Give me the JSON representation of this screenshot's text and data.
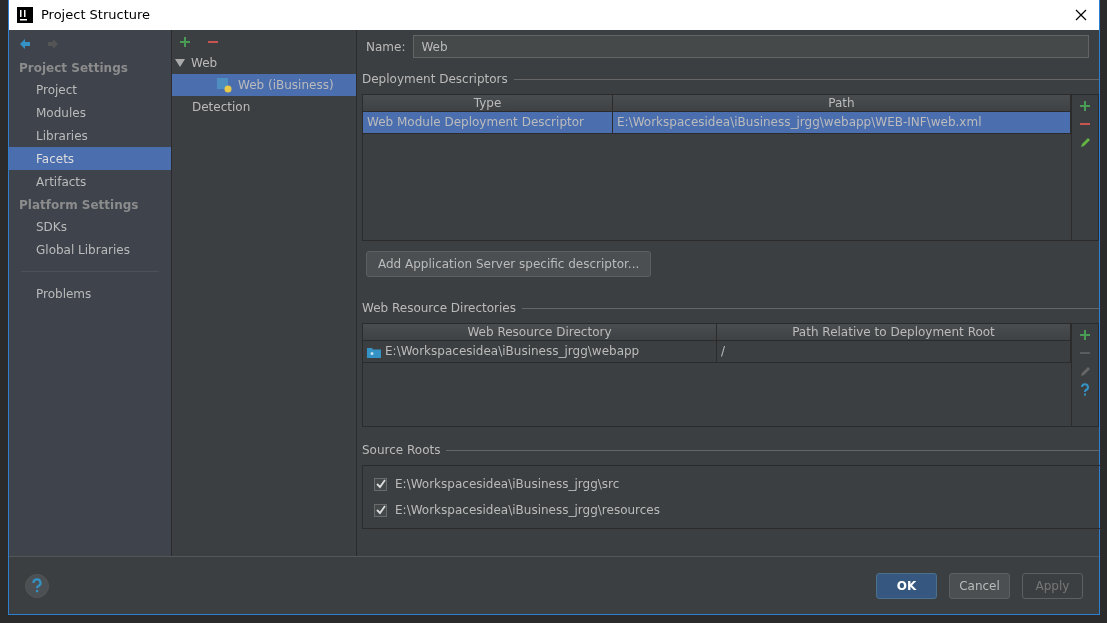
{
  "window": {
    "title": "Project Structure"
  },
  "nav": [
    {
      "kind": "back",
      "disabled": false
    },
    {
      "kind": "forward",
      "disabled": true
    }
  ],
  "sidebar": {
    "items": [
      {
        "kind": "header",
        "label": "Project Settings"
      },
      {
        "kind": "item",
        "label": "Project",
        "selected": false
      },
      {
        "kind": "item",
        "label": "Modules",
        "selected": false
      },
      {
        "kind": "item",
        "label": "Libraries",
        "selected": false
      },
      {
        "kind": "item",
        "label": "Facets",
        "selected": true
      },
      {
        "kind": "item",
        "label": "Artifacts",
        "selected": false
      },
      {
        "kind": "header",
        "label": "Platform Settings"
      },
      {
        "kind": "item",
        "label": "SDKs",
        "selected": false
      },
      {
        "kind": "item",
        "label": "Global Libraries",
        "selected": false
      },
      {
        "kind": "divider"
      },
      {
        "kind": "item",
        "label": "Problems",
        "selected": false
      }
    ]
  },
  "tree": {
    "items": [
      {
        "label": "Web",
        "expanded": true,
        "selected": false,
        "children": [
          {
            "label": "Web (iBusiness)",
            "selected": true
          }
        ]
      },
      {
        "label": "Detection",
        "selected": false
      }
    ]
  },
  "name_field": {
    "label": "Name:",
    "value": "Web"
  },
  "deployment_descriptors": {
    "title": "Deployment Descriptors",
    "columns": [
      "Type",
      "Path"
    ],
    "rows": [
      {
        "cells": [
          "Web Module Deployment Descriptor",
          "E:\\Workspacesidea\\iBusiness_jrgg\\webapp\\WEB-INF\\web.xml"
        ],
        "selected": true
      }
    ],
    "toolbar": [
      {
        "kind": "add",
        "disabled": false
      },
      {
        "kind": "remove",
        "disabled": false
      },
      {
        "kind": "edit",
        "disabled": false
      }
    ],
    "button": "Add Application Server specific descriptor..."
  },
  "web_resource_directories": {
    "title": "Web Resource Directories",
    "columns": [
      "Web Resource Directory",
      "Path Relative to Deployment Root"
    ],
    "rows": [
      {
        "cells": [
          "E:\\Workspacesidea\\iBusiness_jrgg\\webapp",
          "/"
        ],
        "selected": false
      }
    ],
    "toolbar": [
      {
        "kind": "add",
        "disabled": false
      },
      {
        "kind": "remove",
        "disabled": true
      },
      {
        "kind": "edit",
        "disabled": true
      },
      {
        "kind": "help",
        "disabled": false
      }
    ]
  },
  "source_roots": {
    "title": "Source Roots",
    "items": [
      {
        "path": "E:\\Workspacesidea\\iBusiness_jrgg\\src",
        "checked": true
      },
      {
        "path": "E:\\Workspacesidea\\iBusiness_jrgg\\resources",
        "checked": true
      }
    ]
  },
  "buttons": [
    {
      "label": "OK",
      "kind": "default",
      "disabled": false
    },
    {
      "label": "Cancel",
      "kind": "normal",
      "disabled": false
    },
    {
      "label": "Apply",
      "kind": "normal",
      "disabled": true
    }
  ]
}
